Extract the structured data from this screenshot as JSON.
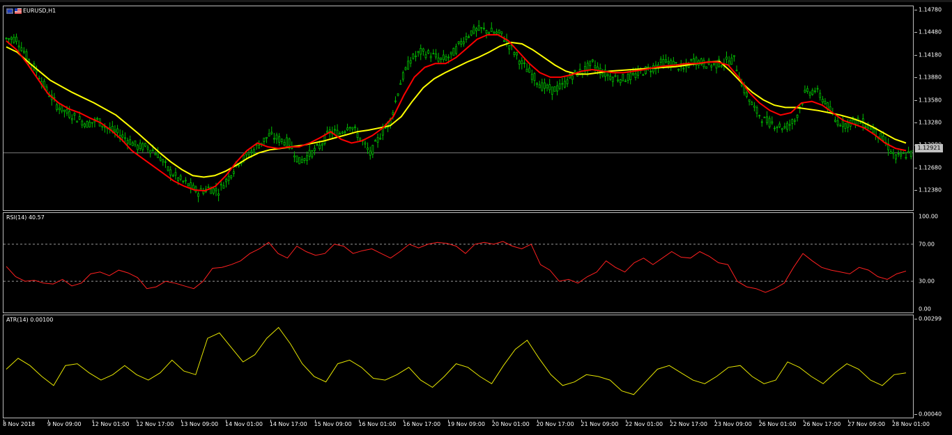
{
  "window": {
    "symbol_title": "EURUSD,H1"
  },
  "colors": {
    "candle": "#00c000",
    "ma_fast": "#ff0000",
    "ma_slow": "#ffff00",
    "rsi": "#ff2020",
    "atr": "#e6e600",
    "grid": "#c0c0c0"
  },
  "main": {
    "price_axis": [
      "1.14780",
      "1.14480",
      "1.14180",
      "1.13880",
      "1.13580",
      "1.13280",
      "1.12980",
      "1.12680",
      "1.12380"
    ],
    "current_price": "1.12921",
    "current_price_value": 1.12921
  },
  "rsi": {
    "title": "RSI(14) 40.57",
    "axis": [
      "100.00",
      "70.00",
      "30.00",
      "0.00"
    ],
    "levels": [
      70,
      30
    ]
  },
  "atr": {
    "title": "ATR(14) 0.00100",
    "axis": [
      "0.00299",
      "0.00040"
    ]
  },
  "time_axis": [
    "8 Nov 2018",
    "9 Nov 09:00",
    "12 Nov 01:00",
    "12 Nov 17:00",
    "13 Nov 09:00",
    "14 Nov 01:00",
    "14 Nov 17:00",
    "15 Nov 09:00",
    "16 Nov 01:00",
    "16 Nov 17:00",
    "19 Nov 09:00",
    "20 Nov 01:00",
    "20 Nov 17:00",
    "21 Nov 09:00",
    "22 Nov 01:00",
    "22 Nov 17:00",
    "23 Nov 09:00",
    "26 Nov 01:00",
    "26 Nov 17:00",
    "27 Nov 09:00",
    "28 Nov 01:00"
  ],
  "chart_data": [
    {
      "type": "line",
      "chart_kind": "candlestick",
      "title": "EURUSD,H1",
      "series": [
        {
          "name": "close",
          "values": [
            1.1443,
            1.142,
            1.14,
            1.1375,
            1.1355,
            1.1345,
            1.1338,
            1.133,
            1.1335,
            1.1325,
            1.1318,
            1.131,
            1.13,
            1.13,
            1.129,
            1.127,
            1.1258,
            1.125,
            1.124,
            1.1245,
            1.1242,
            1.126,
            1.128,
            1.129,
            1.1303,
            1.1315,
            1.131,
            1.1305,
            1.128,
            1.129,
            1.13,
            1.132,
            1.1318,
            1.133,
            1.1312,
            1.129,
            1.1315,
            1.1335,
            1.1385,
            1.1415,
            1.1425,
            1.1422,
            1.1415,
            1.142,
            1.1438,
            1.1452,
            1.1455,
            1.1452,
            1.1448,
            1.143,
            1.141,
            1.1395,
            1.138,
            1.1375,
            1.138,
            1.1395,
            1.14,
            1.141,
            1.1398,
            1.1392,
            1.139,
            1.1393,
            1.14,
            1.1405,
            1.1412,
            1.141,
            1.1402,
            1.1415,
            1.141,
            1.1408,
            1.1412,
            1.1415,
            1.1375,
            1.135,
            1.1335,
            1.133,
            1.1325,
            1.1335,
            1.137,
            1.1375,
            1.136,
            1.1335,
            1.133,
            1.1335,
            1.133,
            1.132,
            1.1305,
            1.1285,
            1.129,
            1.1292
          ]
        },
        {
          "name": "ma_fast",
          "values": [
            1.144,
            1.1428,
            1.141,
            1.139,
            1.137,
            1.1358,
            1.135,
            1.1345,
            1.1338,
            1.1332,
            1.1322,
            1.131,
            1.1295,
            1.1285,
            1.1275,
            1.1265,
            1.1255,
            1.1248,
            1.1243,
            1.1242,
            1.1248,
            1.1262,
            1.128,
            1.1295,
            1.1305,
            1.13,
            1.1298,
            1.13,
            1.13,
            1.1305,
            1.1312,
            1.132,
            1.131,
            1.1305,
            1.1308,
            1.1315,
            1.1325,
            1.134,
            1.1368,
            1.1392,
            1.1405,
            1.141,
            1.141,
            1.1418,
            1.143,
            1.1442,
            1.1448,
            1.1448,
            1.144,
            1.1425,
            1.141,
            1.1398,
            1.1392,
            1.1392,
            1.1395,
            1.14,
            1.1402,
            1.14,
            1.1398,
            1.1398,
            1.14,
            1.1402,
            1.1405,
            1.1407,
            1.1408,
            1.141,
            1.141,
            1.1412,
            1.1412,
            1.1408,
            1.1392,
            1.1372,
            1.1358,
            1.1348,
            1.1342,
            1.1345,
            1.1358,
            1.136,
            1.1355,
            1.1345,
            1.1335,
            1.133,
            1.1325,
            1.1316,
            1.1305,
            1.1298,
            1.1295
          ]
        },
        {
          "name": "ma_slow",
          "values": [
            1.1432,
            1.1425,
            1.1412,
            1.14,
            1.1388,
            1.138,
            1.1372,
            1.1365,
            1.1358,
            1.135,
            1.1342,
            1.133,
            1.1318,
            1.1305,
            1.1292,
            1.128,
            1.127,
            1.1262,
            1.126,
            1.1262,
            1.1268,
            1.1276,
            1.1285,
            1.1292,
            1.1296,
            1.1298,
            1.13,
            1.1302,
            1.1305,
            1.1308,
            1.1312,
            1.1316,
            1.132,
            1.1322,
            1.1325,
            1.1328,
            1.134,
            1.136,
            1.1378,
            1.139,
            1.1398,
            1.1405,
            1.1412,
            1.1418,
            1.1425,
            1.1433,
            1.1438,
            1.1436,
            1.1428,
            1.1418,
            1.1408,
            1.14,
            1.1396,
            1.1396,
            1.1398,
            1.14,
            1.1401,
            1.1402,
            1.1403,
            1.1404,
            1.1405,
            1.1406,
            1.1408,
            1.141,
            1.1412,
            1.1413,
            1.14,
            1.1385,
            1.1372,
            1.1362,
            1.1355,
            1.1352,
            1.1352,
            1.135,
            1.1348,
            1.1345,
            1.1342,
            1.1338,
            1.1333,
            1.1326,
            1.1318,
            1.131,
            1.1305
          ]
        }
      ],
      "ylim": [
        1.122,
        1.1482
      ]
    },
    {
      "type": "line",
      "title": "RSI(14) 40.57",
      "series": [
        {
          "name": "RSI(14)",
          "values": [
            46,
            35,
            30,
            31,
            28,
            27,
            32,
            25,
            28,
            38,
            40,
            36,
            42,
            39,
            34,
            22,
            24,
            30,
            28,
            25,
            22,
            30,
            44,
            45,
            48,
            52,
            60,
            65,
            72,
            60,
            55,
            68,
            62,
            58,
            60,
            70,
            68,
            60,
            63,
            65,
            60,
            55,
            62,
            70,
            66,
            70,
            72,
            71,
            68,
            60,
            70,
            72,
            70,
            73,
            68,
            65,
            70,
            48,
            42,
            30,
            32,
            28,
            35,
            40,
            52,
            45,
            40,
            50,
            55,
            48,
            55,
            62,
            56,
            55,
            62,
            57,
            50,
            48,
            30,
            24,
            22,
            18,
            22,
            28,
            45,
            60,
            52,
            45,
            42,
            40,
            38,
            45,
            42,
            35,
            32,
            38,
            41
          ]
        }
      ],
      "levels": [
        70,
        30
      ],
      "ylim": [
        0,
        100
      ]
    },
    {
      "type": "line",
      "title": "ATR(14) 0.00100",
      "series": [
        {
          "name": "ATR(14)",
          "values": [
            0.0016,
            0.0019,
            0.0017,
            0.0014,
            0.00115,
            0.0017,
            0.00175,
            0.0015,
            0.0013,
            0.00145,
            0.0017,
            0.00145,
            0.0013,
            0.0015,
            0.00185,
            0.00155,
            0.00145,
            0.00245,
            0.0026,
            0.0022,
            0.0018,
            0.002,
            0.00245,
            0.00275,
            0.0023,
            0.00175,
            0.0014,
            0.00125,
            0.00175,
            0.00185,
            0.00165,
            0.00135,
            0.0013,
            0.00145,
            0.00165,
            0.0013,
            0.0011,
            0.0014,
            0.00175,
            0.00165,
            0.0014,
            0.0012,
            0.0017,
            0.00215,
            0.0024,
            0.0019,
            0.00145,
            0.00115,
            0.00125,
            0.00145,
            0.0014,
            0.0013,
            0.001,
            0.0009,
            0.00125,
            0.0016,
            0.0017,
            0.0015,
            0.0013,
            0.0012,
            0.0014,
            0.00165,
            0.0017,
            0.0014,
            0.0012,
            0.0013,
            0.0018,
            0.00165,
            0.0014,
            0.0012,
            0.0015,
            0.00175,
            0.0016,
            0.0013,
            0.00115,
            0.00145,
            0.0015
          ]
        }
      ],
      "ylim": [
        0.0004,
        0.00299
      ]
    }
  ]
}
